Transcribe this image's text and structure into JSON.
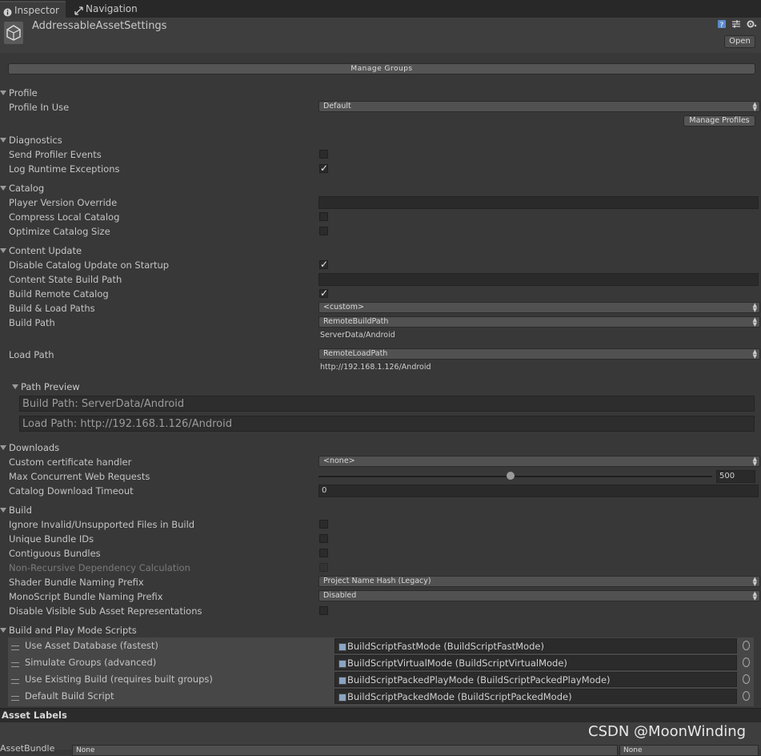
{
  "tabs": [
    {
      "label": "Inspector",
      "icon": "info-icon",
      "active": true
    },
    {
      "label": "Navigation",
      "icon": "navigation-icon",
      "active": false
    }
  ],
  "header": {
    "title": "AddressableAssetSettings",
    "open_label": "Open"
  },
  "manage_groups_label": "Manage Groups",
  "profile": {
    "section": "Profile",
    "profile_in_use_label": "Profile In Use",
    "profile_in_use_value": "Default",
    "manage_profiles_label": "Manage Profiles"
  },
  "diagnostics": {
    "section": "Diagnostics",
    "send_profiler_events": {
      "label": "Send Profiler Events",
      "checked": false
    },
    "log_runtime_exceptions": {
      "label": "Log Runtime Exceptions",
      "checked": true
    }
  },
  "catalog": {
    "section": "Catalog",
    "player_version_override": {
      "label": "Player Version Override",
      "value": ""
    },
    "compress_local_catalog": {
      "label": "Compress Local Catalog",
      "checked": false
    },
    "optimize_catalog_size": {
      "label": "Optimize Catalog Size",
      "checked": false
    }
  },
  "content_update": {
    "section": "Content Update",
    "disable_catalog_update": {
      "label": "Disable Catalog Update on Startup",
      "checked": true
    },
    "content_state_build_path": {
      "label": "Content State Build Path",
      "value": ""
    },
    "build_remote_catalog": {
      "label": "Build Remote Catalog",
      "checked": true
    },
    "build_load_paths": {
      "label": "Build & Load Paths",
      "value": "<custom>"
    },
    "build_path": {
      "label": "Build Path",
      "value": "RemoteBuildPath",
      "resolved": "ServerData/Android"
    },
    "load_path": {
      "label": "Load Path",
      "value": "RemoteLoadPath",
      "resolved": "http://192.168.1.126/Android"
    },
    "path_preview": {
      "label": "Path Preview",
      "build": "Build Path: ServerData/Android",
      "load": "Load Path: http://192.168.1.126/Android"
    }
  },
  "downloads": {
    "section": "Downloads",
    "custom_cert": {
      "label": "Custom certificate handler",
      "value": "<none>"
    },
    "max_web_requests": {
      "label": "Max Concurrent Web Requests",
      "value": "500"
    },
    "timeout": {
      "label": "Catalog Download Timeout",
      "value": "0"
    }
  },
  "build": {
    "section": "Build",
    "ignore_invalid": {
      "label": "Ignore Invalid/Unsupported Files in Build",
      "checked": false
    },
    "unique_bundle_ids": {
      "label": "Unique Bundle IDs",
      "checked": false
    },
    "contiguous_bundles": {
      "label": "Contiguous Bundles",
      "checked": false
    },
    "non_recursive": {
      "label": "Non-Recursive Dependency Calculation",
      "checked": false
    },
    "shader_prefix": {
      "label": "Shader Bundle Naming Prefix",
      "value": "Project Name Hash (Legacy)"
    },
    "monoscript_prefix": {
      "label": "MonoScript Bundle Naming Prefix",
      "value": "Disabled"
    },
    "disable_sub_asset": {
      "label": "Disable Visible Sub Asset Representations",
      "checked": false
    }
  },
  "build_play_mode": {
    "section": "Build and Play Mode Scripts",
    "scripts": [
      {
        "label": "Use Asset Database (fastest)",
        "script": "BuildScriptFastMode (BuildScriptFastMode)"
      },
      {
        "label": "Simulate Groups (advanced)",
        "script": "BuildScriptVirtualMode (BuildScriptVirtualMode)"
      },
      {
        "label": "Use Existing Build (requires built groups)",
        "script": "BuildScriptPackedPlayMode (BuildScriptPackedPlayMode)"
      },
      {
        "label": "Default Build Script",
        "script": "BuildScriptPackedMode (BuildScriptPackedMode)"
      }
    ]
  },
  "asset_labels": "Asset Labels",
  "footer": {
    "asset_bundle_label": "AssetBundle",
    "bundle_value": "None",
    "variant_value": "None"
  },
  "watermark": "CSDN @MoonWinding",
  "slider": {
    "fraction": 0.48
  }
}
